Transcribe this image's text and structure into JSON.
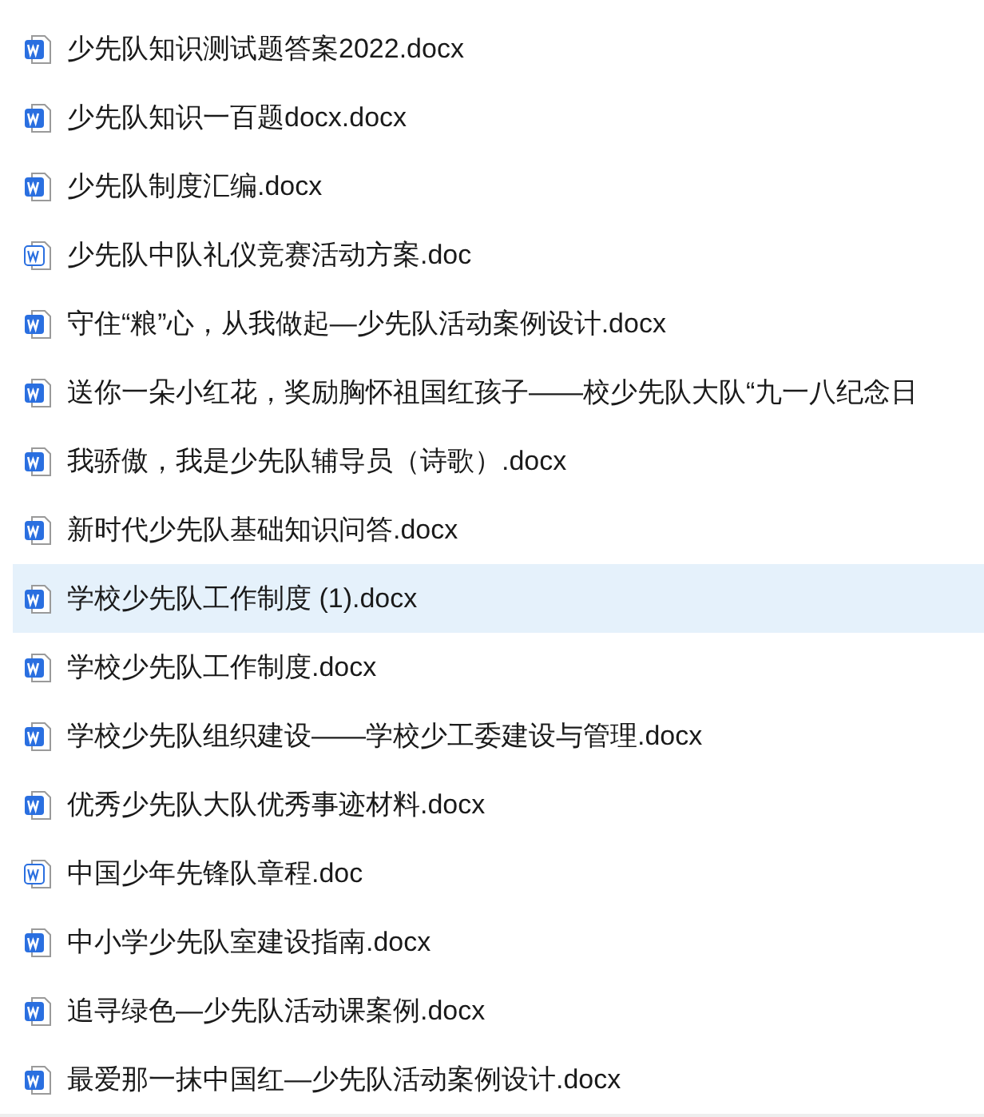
{
  "files": [
    {
      "name": "少先队知识测试题答案2022.docx",
      "kind": "docx",
      "selected": false
    },
    {
      "name": "少先队知识一百题docx.docx",
      "kind": "docx",
      "selected": false
    },
    {
      "name": "少先队制度汇编.docx",
      "kind": "docx",
      "selected": false
    },
    {
      "name": "少先队中队礼仪竞赛活动方案.doc",
      "kind": "doc",
      "selected": false
    },
    {
      "name": "守住“粮”心，从我做起—少先队活动案例设计.docx",
      "kind": "docx",
      "selected": false
    },
    {
      "name": "送你一朵小红花，奖励胸怀祖国红孩子——校少先队大队“九一八纪念日",
      "kind": "docx",
      "selected": false
    },
    {
      "name": "我骄傲，我是少先队辅导员（诗歌）.docx",
      "kind": "docx",
      "selected": false
    },
    {
      "name": "新时代少先队基础知识问答.docx",
      "kind": "docx",
      "selected": false
    },
    {
      "name": "学校少先队工作制度 (1).docx",
      "kind": "docx",
      "selected": true
    },
    {
      "name": "学校少先队工作制度.docx",
      "kind": "docx",
      "selected": false
    },
    {
      "name": "学校少先队组织建设——学校少工委建设与管理.docx",
      "kind": "docx",
      "selected": false
    },
    {
      "name": "优秀少先队大队优秀事迹材料.docx",
      "kind": "docx",
      "selected": false
    },
    {
      "name": "中国少年先锋队章程.doc",
      "kind": "doc",
      "selected": false
    },
    {
      "name": "中小学少先队室建设指南.docx",
      "kind": "docx",
      "selected": false
    },
    {
      "name": "追寻绿色—少先队活动课案例.docx",
      "kind": "docx",
      "selected": false
    },
    {
      "name": "最爱那一抹中国红—少先队活动案例设计.docx",
      "kind": "docx",
      "selected": false
    }
  ]
}
